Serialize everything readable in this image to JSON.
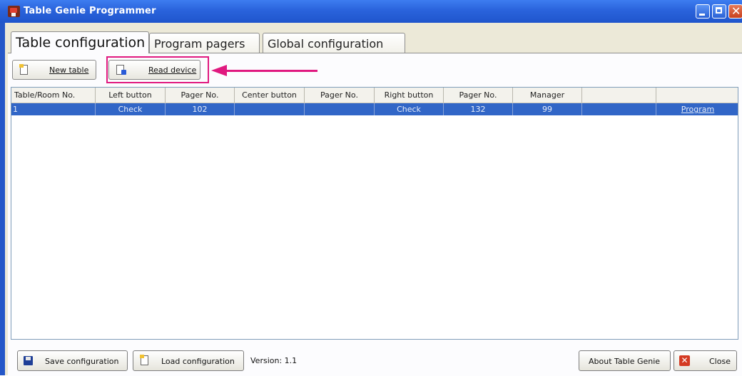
{
  "window": {
    "title": "Table Genie Programmer"
  },
  "tabs": [
    {
      "label": "Table configuration",
      "active": true
    },
    {
      "label": "Program pagers",
      "active": false
    },
    {
      "label": "Global configuration",
      "active": false
    }
  ],
  "toolbar": {
    "new_table_label": "New table",
    "read_device_label": "Read device"
  },
  "grid": {
    "columns": [
      "Table/Room No.",
      "Left button",
      "Pager No.",
      "Center button",
      "Pager No.",
      "Right button",
      "Pager No.",
      "Manager",
      "",
      ""
    ],
    "rows": [
      [
        "1",
        "Check",
        "102",
        "",
        "",
        "Check",
        "132",
        "99",
        "",
        "Program"
      ]
    ]
  },
  "footer": {
    "save_label": "Save configuration",
    "load_label": "Load configuration",
    "version": "Version: 1.1",
    "about_label": "About Table Genie",
    "close_label": "Close"
  },
  "colors": {
    "titlebar": "#2a63dc",
    "selected_row": "#3166c7",
    "annotation": "#e0197f"
  },
  "icons": {
    "app": "table-genie-app-icon",
    "new_table": "new-document-icon",
    "read_device": "read-device-icon",
    "save": "floppy-disk-icon",
    "load": "load-document-icon",
    "close": "red-x-icon"
  }
}
